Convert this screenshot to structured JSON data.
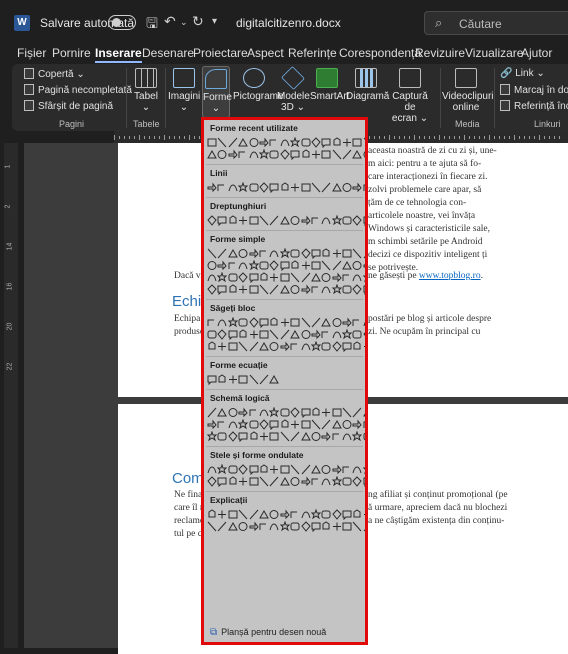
{
  "titlebar": {
    "autosave_label": "Salvare automată",
    "doc_name": "digitalcitizenro.docx",
    "search_placeholder": "Căutare",
    "app_logo": "W"
  },
  "tabs": [
    "Fișier",
    "Pornire",
    "Inserare",
    "Desenare",
    "Proiectare",
    "Aspect",
    "Referințe",
    "Corespondență",
    "Revizuire",
    "Vizualizare",
    "Ajutor"
  ],
  "active_tab": "Inserare",
  "ribbon": {
    "pages_group": {
      "cover": "Copertă",
      "blank": "Pagină necompletată",
      "break": "Sfârșit de pagină",
      "label": "Pagini"
    },
    "tables_group": {
      "table": "Tabel",
      "label": "Tabele"
    },
    "illustrations": {
      "images": "Imagini",
      "shapes": "Forme",
      "pictograms": "Pictograme",
      "models3d_1": "Modele",
      "models3d_2": "3D",
      "smartart": "SmartArt",
      "chart": "Diagramă",
      "screenshot_1": "Captură de",
      "screenshot_2": "ecran"
    },
    "media_group": {
      "video_1": "Videoclipuri",
      "video_2": "online",
      "label": "Media"
    },
    "links_group": {
      "link": "Link",
      "bookmark": "Marcaj în docu",
      "crossref": "Referință încruc",
      "label": "Linkuri"
    }
  },
  "document": {
    "page1_lines": [
      "aceasta noastră de zi cu zi și, une-",
      "m aici: pentru a te ajuta să fo-",
      "care interacționezi în fiecare zi.",
      "zolvi problemele care apar, să",
      "țăm de ce tehnologia con-",
      "articolele noastre, vei învăța",
      "Windows și caracteristicile sale,",
      "m schimbi setările pe Android",
      "decizi ce dispozitiv inteligent ți",
      "se potrivește."
    ],
    "page1_para_left": "Dacă vrei",
    "page1_para_right": "ne găsești pe",
    "page1_link": "www.topblog.ro",
    "heading1": "Echipa",
    "team_left1": "Echipa D",
    "team_right1": "postări pe blog și articole despre",
    "team_left2": "produse",
    "team_right2": "zi. Ne ocupăm în principal cu",
    "heading2": "Comp",
    "p2_lines_left": [
      "Ne finan",
      "care îl m",
      "reclame",
      "tul pe ca"
    ],
    "p2_lines_right": [
      "ng afiliat și conținut promoțional (pe",
      "ă urmare, apreciem dacă nu blochezi",
      "a ne câștigăm existența din conținu-",
      ""
    ]
  },
  "shapes_panel": {
    "sections": [
      {
        "title": "Forme recent utilizate",
        "rows": 2
      },
      {
        "title": "Linii",
        "rows": 1
      },
      {
        "title": "Dreptunghiuri",
        "rows": 1
      },
      {
        "title": "Forme simple",
        "rows": 4
      },
      {
        "title": "Săgeți bloc",
        "rows": 3
      },
      {
        "title": "Forme ecuație",
        "rows": 1
      },
      {
        "title": "Schemă logică",
        "rows": 3
      },
      {
        "title": "Stele și forme ondulate",
        "rows": 2
      },
      {
        "title": "Explicații",
        "rows": 2
      }
    ],
    "footer": "Planșă pentru desen nouă"
  }
}
